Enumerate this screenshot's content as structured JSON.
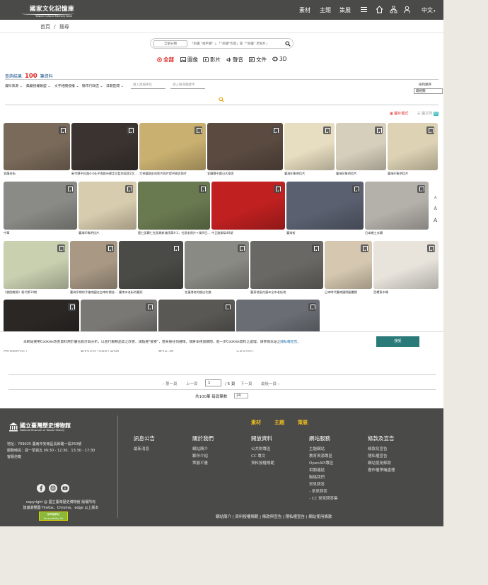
{
  "header": {
    "logo_title": "國家文化記憶庫",
    "logo_subtitle": "Taiwan Cultural Memory Bank",
    "nav": [
      "素材",
      "主題",
      "策展"
    ],
    "icons": [
      "menu-icon",
      "home-icon",
      "sitemap-icon",
      "user-icon"
    ],
    "language": "中文",
    "language_arrow": "▾"
  },
  "breadcrumb": {
    "home": "首頁",
    "sep": "/",
    "current": "搜尋"
  },
  "search": {
    "scope": "全部分類",
    "query": "「串鐵 \"福平路\" 」、「\"串鐵\"作景」或「\"串鐵\" 老照片」"
  },
  "content_tabs": [
    {
      "label": "全部",
      "icon": "all-icon"
    },
    {
      "label": "圖像",
      "icon": "image-icon"
    },
    {
      "label": "影片",
      "icon": "video-icon"
    },
    {
      "label": "聲音",
      "icon": "audio-icon"
    },
    {
      "label": "文件",
      "icon": "document-icon"
    },
    {
      "label": "3D",
      "icon": "3d-icon"
    }
  ],
  "results": {
    "prefix": "查詢結果",
    "count": "100",
    "suffix": "筆資料"
  },
  "filters": [
    "資料來源",
    "典藏授權聯盟",
    "文字相關授權",
    "縣市行政區",
    "日期區間"
  ],
  "filter_inputs": [
    "請入建檔單位",
    "請入搜尋關鍵字"
  ],
  "sort": {
    "label": "排列順序",
    "value": "最相關"
  },
  "view": {
    "image_mode": "圖片模式",
    "list_mode": "圖文列",
    "list_badge": "切"
  },
  "side_buttons": [
    "A",
    "A",
    "A"
  ],
  "items": [
    {
      "caption": "宜蘭老街",
      "color": "#7a6a5a"
    },
    {
      "caption": "新竹縣平松路4-4社平南路市標定位監控面第2次...",
      "color": "#3a3330"
    },
    {
      "caption": "大來鐵路史的影片照片提供資訊照片",
      "color": "#c9b070"
    },
    {
      "caption": "宜蘭縣平戲日式宿舍",
      "color": "#5a4a40"
    },
    {
      "caption": "臺灣印象明信片",
      "color": "#e7ddc0"
    },
    {
      "caption": "臺灣印象明信片",
      "color": "#d6cfbc"
    },
    {
      "caption": "臺灣印象明信片",
      "color": "#ddd2b4"
    },
    {
      "caption": "中華",
      "color": "#8a8a86"
    },
    {
      "caption": "臺灣印象明信片",
      "color": "#d8ccae"
    },
    {
      "caption": "鹿仁區縣仁社區鼎新塊頂第4-3，社區老照片+改四日...",
      "color": "#6a7a50"
    },
    {
      "caption": "中正路郵局40號",
      "color": "#c02020"
    },
    {
      "caption": "臺灣街",
      "color": "#5a6070"
    },
    {
      "caption": "日本鄉土玄關",
      "color": "#b4b0aa"
    },
    {
      "caption": "《桃園鄉源》客代第10期",
      "color": "#c8d0b0"
    },
    {
      "caption": "臺灣早期的手繪地圖在台南的標誌...",
      "color": "#a89884"
    },
    {
      "caption": "臺南市老街的舊照",
      "color": "#4a4a46"
    },
    {
      "caption": "花蓮港老的飯店北路",
      "color": "#8a8a84"
    },
    {
      "caption": "臺東地區花蓮市全市老街地",
      "color": "#6a6864"
    },
    {
      "caption": "日本時代臺南國際圖書館",
      "color": "#d6c8b0"
    },
    {
      "caption": "西螺東市場",
      "color": "#e8e4dc"
    },
    {
      "caption": "攝影機鏡頭的影片",
      "color": "#2a2724"
    },
    {
      "caption": "鹿港老街照片老店鋪中山北路",
      "color": "#7a7874"
    },
    {
      "caption": "臺南古門鐵",
      "color": "#5a5854"
    },
    {
      "caption": "往昔老街照片",
      "color": "#6a6e74"
    }
  ],
  "cookie": {
    "text": "本網站使用Cookies改善資料用於優化統計與分析，以進行服務品質之改善，請點選\"接受\"，若未按任何選擇，或將本視窗關閉，進一步Cookies資料之處理，請參閱本站之",
    "link": "隱私權宣告。",
    "accept": "接受"
  },
  "pagination": {
    "first": "‹ 第一頁",
    "prev": "上一頁",
    "current": "1",
    "total": "/ 5 頁",
    "next": "下一頁",
    "last": "最後一頁 ›",
    "summary": "共100筆 每頁筆數",
    "per_page": "24"
  },
  "footer": {
    "logo_title": "國立臺灣歷史博物館",
    "logo_subtitle": "National Museum of Taiwan History",
    "address": "地址：709025 臺南市安南區長和路一段250號",
    "hours": "服務時段：週一至週五 09:30 - 12:30、13:30 - 17:30",
    "contact": "客服信箱",
    "social": [
      "facebook-icon",
      "instagram-icon",
      "youtube-icon"
    ],
    "copyright": "copyright @ 國立臺灣歷史博物館 版權所有",
    "browser": "建議瀏覽器 Firefox、Chrome、edge 以上版本",
    "badge": "無障礙網站 Accessibility AA",
    "top_links": [
      "素材",
      "主題",
      "策展"
    ],
    "columns": [
      {
        "title": "訊息公告",
        "links": [
          "最新消息"
        ]
      },
      {
        "title": "關於我們",
        "links": [
          "網站簡介",
          "夥伴介紹",
          "策展平臺"
        ]
      },
      {
        "title": "開放資料",
        "links": [
          "公共財專區",
          "CC 專文",
          "資料授權規範"
        ]
      },
      {
        "title": "網站服務",
        "links": [
          "主題網站",
          "教育資源專區",
          "OpenAPI專區",
          "相關連結",
          "聯絡我們",
          "常見問答",
          "- 常見問答",
          "- CC 常見問答集"
        ]
      },
      {
        "title": "條款及宣告",
        "links": [
          "條款及宣告",
          "隱私權宣告",
          "網站使用條款",
          "著作權爭議處理"
        ]
      }
    ],
    "bottom": "網站簡介 | 資料授權規範 | 條款與宣告 | 隱私權宣告 | 網站使用條款"
  }
}
